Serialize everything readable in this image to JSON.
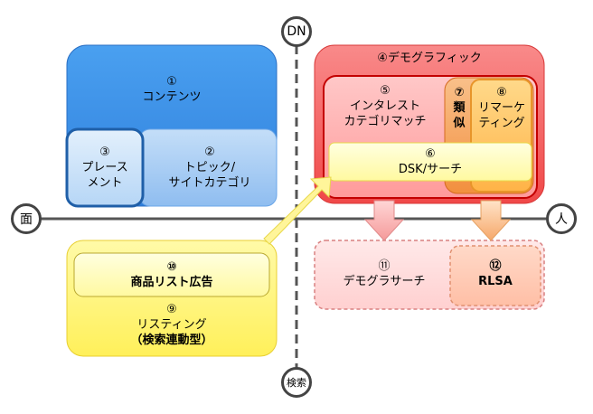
{
  "axes": {
    "top": "DN",
    "bottom": "検索",
    "left": "面",
    "right": "人"
  },
  "nodes": {
    "contents": {
      "num": "①",
      "label": "コンテンツ"
    },
    "topic": {
      "num": "②",
      "line1": "トピック/",
      "line2": "サイトカテゴリ"
    },
    "placement": {
      "num": "③",
      "line1": "プレース",
      "line2": "メント"
    },
    "demographic": {
      "num": "④",
      "label": "デモグラフィック"
    },
    "interest": {
      "num": "⑤",
      "line1": "インタレスト",
      "line2": "カテゴリマッチ"
    },
    "dsk": {
      "num": "⑥",
      "label": "DSK/サーチ"
    },
    "similar": {
      "num": "⑦",
      "line1": "類",
      "line2": "似"
    },
    "remarketing": {
      "num": "⑧",
      "line1": "リマーケ",
      "line2": "ティング"
    },
    "listing": {
      "num": "⑨",
      "line1": "リスティング",
      "line2": "（検索連動型）"
    },
    "shopping": {
      "num": "⑩",
      "label": "商品リスト広告"
    },
    "demo_search": {
      "num": "⑪",
      "label": "デモグラサーチ"
    },
    "rlsa": {
      "num": "⑫",
      "label": "RLSA"
    }
  },
  "colors": {
    "blue": "#3a8ee6",
    "light_blue": "#a9cdf4",
    "red": "#f25a5a",
    "pink": "#ffb3b3",
    "orange": "#f6a25a",
    "yellow": "#fff37a",
    "light_yellow": "#ffffb0",
    "axis": "#555555"
  }
}
